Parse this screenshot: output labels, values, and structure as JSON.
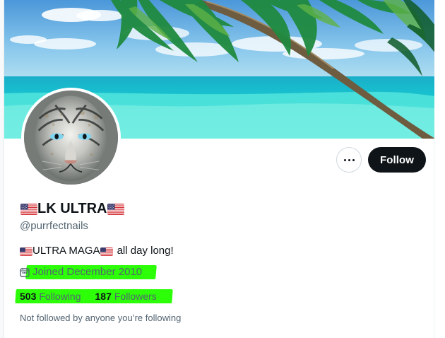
{
  "profile": {
    "display_name": "LK ULTRA",
    "handle": "@purrfectnails",
    "bio_main": "ULTRA MAGA",
    "bio_suffix": "all day long!",
    "joined": "Joined December 2010",
    "following_count": "503",
    "following_label": "Following",
    "followers_count": "187",
    "followers_label": "Followers",
    "followed_by_text": "Not followed by anyone you’re following"
  },
  "actions": {
    "follow_label": "Follow"
  },
  "icons": {
    "more": "more-horizontal-icon",
    "calendar": "calendar-icon",
    "flag": "us-flag-icon"
  },
  "colors": {
    "follow_button": "#0f1419",
    "secondary_text": "#536471",
    "highlight": "#2cff07"
  }
}
